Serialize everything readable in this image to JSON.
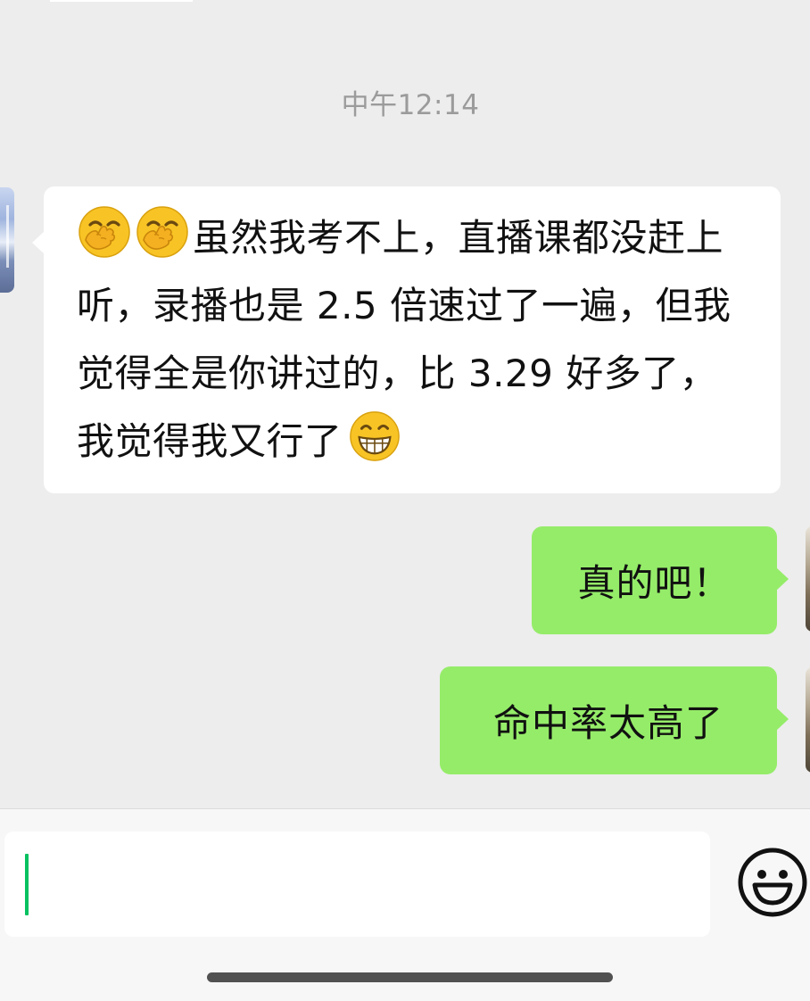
{
  "timestamp": "中午12:14",
  "messages": [
    {
      "sender": "contact",
      "emojis_before": [
        "hand-over-mouth-emoji",
        "hand-over-mouth-emoji"
      ],
      "text": "虽然我考不上，直播课都没赶上听，录播也是 2.5 倍速过了一遍，但我觉得全是你讲过的，比 3.29 好多了，我觉得我又行了",
      "emoji_after": "grinning-face-emoji"
    },
    {
      "sender": "me",
      "text": "真的吧！"
    },
    {
      "sender": "me",
      "text": "命中率太高了"
    }
  ],
  "input": {
    "value": ""
  },
  "icons": {
    "emoji_button": "smiley-face-icon"
  },
  "colors": {
    "chat_background": "#ededed",
    "incoming_bubble": "#ffffff",
    "outgoing_bubble": "#95ec69",
    "caret": "#07c160"
  }
}
